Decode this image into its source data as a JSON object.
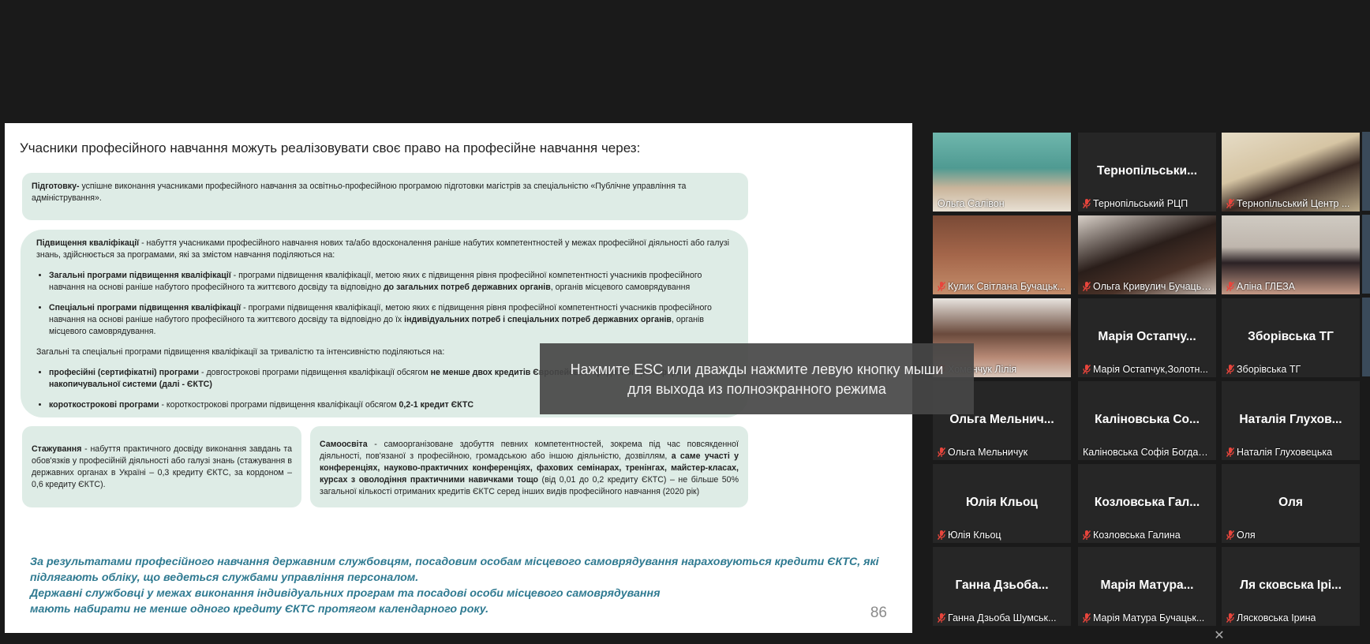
{
  "slide": {
    "title": "Учасники професійного навчання можуть реалізовувати своє право на професійне навчання через:",
    "box1": {
      "term": "Підготовку-",
      "text": " успішне виконання учасниками професійного навчання за освітньо-професійною програмою підготовки магістрів за спеціальністю «Публічне управління та адміністрування»."
    },
    "box2": {
      "term": "Підвищення кваліфікації",
      "intro": " - набуття учасниками професійного навчання нових та/або вдосконалення раніше набутих компетентностей у межах професійної діяльності або галузі знань, здійснюється за програмами, які за змістом навчання поділяються на:",
      "b1_term": "Загальні програми підвищення кваліфікації",
      "b1_text": " - програми підвищення кваліфікації, метою яких є підвищення рівня професійної компетентності учасників професійного навчання на основі раніше набутого професійного та життєвого досвіду та відповідно ",
      "b1_bold": "до загальних потреб державних органів",
      "b1_end": ", органів місцевого самоврядування",
      "b2_term": "Спеціальні програми підвищення кваліфікації",
      "b2_text": " - програми підвищення кваліфікації, метою яких є підвищення рівня професійної компетентності учасників професійного навчання на основі раніше набутого професійного та життєвого досвіду та відповідно до їх ",
      "b2_bold": "індивідуальних потреб і спеціальних потреб державних органів",
      "b2_end": ", органів місцевого самоврядування.",
      "sub_intro": "Загальні та спеціальні програми підвищення кваліфікації за тривалістю та інтенсивністю поділяються на:",
      "b3_term": "професійні (сертифікатні) програми",
      "b3_text": " - довгострокові програми підвищення кваліфікації обсягом ",
      "b3_bold": "не менше двох кредитів Європейської кредитної трансферно-накопичувальної системи (далі - ЄКТС)",
      "b4_term": "короткострокові програми",
      "b4_text": " - короткострокові програми підвищення кваліфікації обсягом ",
      "b4_bold": "0,2-1 кредит ЄКТС"
    },
    "box3": {
      "term": "Стажування",
      "text": " - набуття практичного досвіду виконання завдань та обов'язків у професійній діяльності або галузі знань (стажування в державних органах в Україні – 0,3 кредиту ЄКТС, за кордоном – 0,6 кредиту ЄКТС)."
    },
    "box4": {
      "term": "Самоосвіта",
      "text": " - самоорганізоване здобуття певних компетентностей, зокрема під час повсякденної діяльності, пов'язаної з професійною, громадською або іншою діяльністю, дозвіллям, ",
      "bold": "а саме участі у конференціях, науково-практичних конференціях, фахових семінарах, тренінгах, майстер-класах, курсах з оволодіння практичними навичками тощо",
      "end": " (від 0,01 до 0,2 кредиту ЄКТС) – не більше 50% загальної кількості отриманих кредитів ЄКТС серед інших видів професійного навчання (2020 рік)"
    },
    "closing_1": "За результатами професійного навчання державним службовцям, посадовим особам місцевого самоврядування нараховуються кредити ЄКТС, які підлягають обліку, що ведеться службами управління персоналом.",
    "closing_2": "Державні службовці у межах виконання індивідуальних програм та посадові особи місцевого самоврядування",
    "closing_3": "мають набирати не менше одного кредиту ЄКТС протягом календарного року.",
    "page_number": "86"
  },
  "toast": {
    "line1": "Нажмите ESC или дважды нажмите левую кнопку мыши",
    "line2": "для выхода из полноэкранного режима"
  },
  "participants": [
    {
      "center": "",
      "label": "Ольга Салівон",
      "muted": false,
      "video": "teal"
    },
    {
      "center": "Тернопільськи...",
      "label": "Тернопільський РЦП",
      "muted": true
    },
    {
      "center": "",
      "label": "Тернопільський Центр ...",
      "muted": true,
      "video": "room"
    },
    {
      "center": "",
      "label": "Кулик Світлана Бучацьк...",
      "muted": true,
      "video": "brown"
    },
    {
      "center": "",
      "label": "Ольга Кривулич Бучацьк...",
      "muted": true,
      "video": "hair"
    },
    {
      "center": "",
      "label": "Аліна ГЛЕЗА",
      "muted": true,
      "video": "woman"
    },
    {
      "center": "",
      "label": "Хоменчук Лілія",
      "muted": true,
      "video": "face"
    },
    {
      "center": "Марія  Остапчу...",
      "label": "Марія Остапчук,Золотн...",
      "muted": true
    },
    {
      "center": "Зборівська ТГ",
      "label": "Зборівська ТГ",
      "muted": true
    },
    {
      "center": "Ольга  Мельнич...",
      "label": "Ольга Мельничук",
      "muted": true
    },
    {
      "center": "Каліновська  Со...",
      "label": "Каліновська Софія Богдані...",
      "muted": false
    },
    {
      "center": "Наталія  Глухов...",
      "label": "Наталія Глуховецька",
      "muted": true
    },
    {
      "center": "Юлія  Кльоц",
      "label": "Юлія Кльоц",
      "muted": true
    },
    {
      "center": "Козловська  Гал...",
      "label": "Козловська Галина",
      "muted": true
    },
    {
      "center": "Оля",
      "label": "Оля",
      "muted": true
    },
    {
      "center": "Ганна  Дзьоба...",
      "label": "Ганна Дзьоба Шумськ...",
      "muted": true
    },
    {
      "center": "Марія  Матура...",
      "label": "Марія Матура Бучацьк...",
      "muted": true
    },
    {
      "center": "Ля сковська  Ірі...",
      "label": "Лясковська Ірина",
      "muted": true
    }
  ],
  "colors": {
    "accent_active": "#d7e76a",
    "muted_icon": "#e8453c",
    "closing_text": "#2f7a91",
    "box_bg": "#deece6"
  }
}
